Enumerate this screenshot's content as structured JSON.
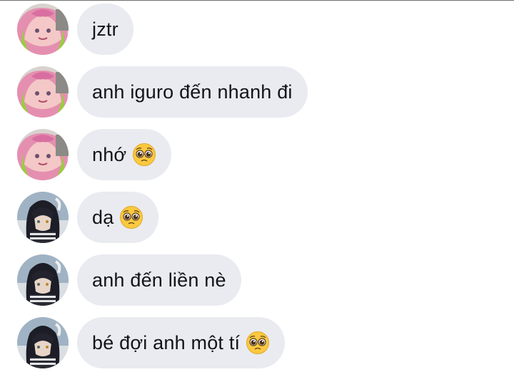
{
  "messages": [
    {
      "sender": "pink-hair-user",
      "text": "jztr",
      "emoji": ""
    },
    {
      "sender": "pink-hair-user",
      "text": "anh iguro đến nhanh đi",
      "emoji": ""
    },
    {
      "sender": "pink-hair-user",
      "text": "nhớ",
      "emoji": "pleading-face"
    },
    {
      "sender": "dark-hair-user",
      "text": "dạ",
      "emoji": "pleading-face"
    },
    {
      "sender": "dark-hair-user",
      "text": "anh đến liền nè",
      "emoji": ""
    },
    {
      "sender": "dark-hair-user",
      "text": "bé đợi anh một tí",
      "emoji": "pleading-face"
    }
  ],
  "colors": {
    "bubble": "#e9ebf0",
    "text": "#111418",
    "emoji_yellow": "#fbc93f"
  }
}
